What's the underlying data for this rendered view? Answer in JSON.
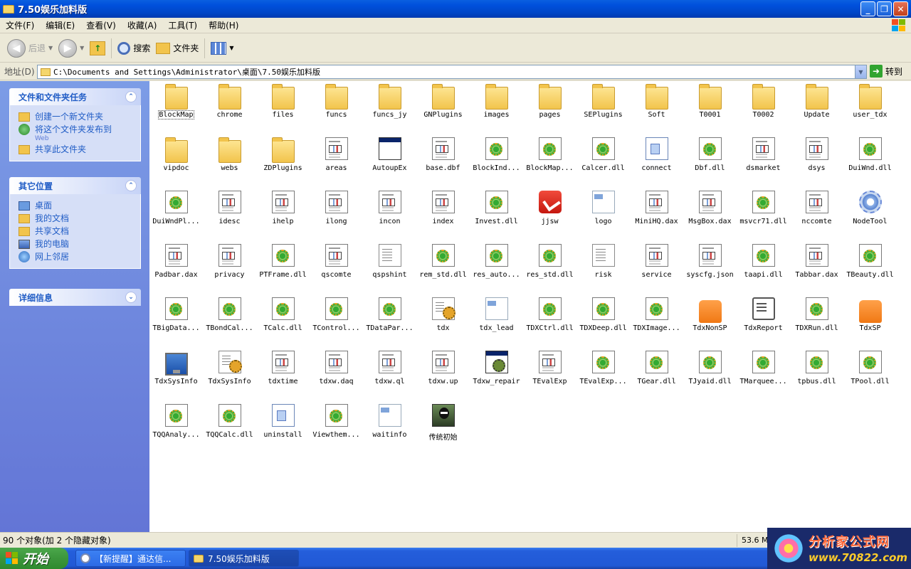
{
  "window": {
    "title": "7.50娱乐加料版",
    "minimize": "_",
    "maximize": "❐",
    "close": "✕"
  },
  "menu": [
    "文件(F)",
    "编辑(E)",
    "查看(V)",
    "收藏(A)",
    "工具(T)",
    "帮助(H)"
  ],
  "toolbar": {
    "back": "后退",
    "search": "搜索",
    "folders": "文件夹"
  },
  "address": {
    "label": "地址(D)",
    "path": "C:\\Documents and Settings\\Administrator\\桌面\\7.50娱乐加料版",
    "go": "转到"
  },
  "left_panels": {
    "tasks": {
      "title": "文件和文件夹任务",
      "items": [
        "创建一个新文件夹",
        "将这个文件夹发布到",
        "共享此文件夹"
      ],
      "publish_sub": "Web"
    },
    "places": {
      "title": "其它位置",
      "items": [
        "桌面",
        "我的文档",
        "共享文档",
        "我的电脑",
        "网上邻居"
      ]
    },
    "details": {
      "title": "详细信息"
    }
  },
  "files": [
    {
      "name": "BlockMap",
      "icon": "folder"
    },
    {
      "name": "chrome",
      "icon": "folder"
    },
    {
      "name": "files",
      "icon": "folder"
    },
    {
      "name": "funcs",
      "icon": "folder"
    },
    {
      "name": "funcs_jy",
      "icon": "folder"
    },
    {
      "name": "GNPlugins",
      "icon": "folder"
    },
    {
      "name": "images",
      "icon": "folder"
    },
    {
      "name": "pages",
      "icon": "folder"
    },
    {
      "name": "SEPlugins",
      "icon": "folder"
    },
    {
      "name": "Soft",
      "icon": "folder"
    },
    {
      "name": "T0001",
      "icon": "folder"
    },
    {
      "name": "T0002",
      "icon": "folder"
    },
    {
      "name": "Update",
      "icon": "folder"
    },
    {
      "name": "user_tdx",
      "icon": "folder"
    },
    {
      "name": "vipdoc",
      "icon": "folder"
    },
    {
      "name": "webs",
      "icon": "folder"
    },
    {
      "name": "ZDPlugins",
      "icon": "folder"
    },
    {
      "name": "areas",
      "icon": "doc"
    },
    {
      "name": "AutoupEx",
      "icon": "exe"
    },
    {
      "name": "base.dbf",
      "icon": "doc"
    },
    {
      "name": "BlockInd...",
      "icon": "dll"
    },
    {
      "name": "BlockMap...",
      "icon": "dll"
    },
    {
      "name": "Calcer.dll",
      "icon": "dll"
    },
    {
      "name": "connect",
      "icon": "generic"
    },
    {
      "name": "Dbf.dll",
      "icon": "dll"
    },
    {
      "name": "dsmarket",
      "icon": "doc"
    },
    {
      "name": "dsys",
      "icon": "doc"
    },
    {
      "name": "DuiWnd.dll",
      "icon": "dll"
    },
    {
      "name": "DuiWndPl...",
      "icon": "dll"
    },
    {
      "name": "idesc",
      "icon": "doc"
    },
    {
      "name": "ihelp",
      "icon": "doc"
    },
    {
      "name": "ilong",
      "icon": "doc"
    },
    {
      "name": "incon",
      "icon": "doc"
    },
    {
      "name": "index",
      "icon": "doc"
    },
    {
      "name": "Invest.dll",
      "icon": "dll"
    },
    {
      "name": "jjsw",
      "icon": "red"
    },
    {
      "name": "logo",
      "icon": "img"
    },
    {
      "name": "MiniHQ.dax",
      "icon": "doc"
    },
    {
      "name": "MsgBox.dax",
      "icon": "doc"
    },
    {
      "name": "msvcr71.dll",
      "icon": "dll"
    },
    {
      "name": "nccomte",
      "icon": "doc"
    },
    {
      "name": "NodeTool",
      "icon": "gear"
    },
    {
      "name": "Padbar.dax",
      "icon": "doc"
    },
    {
      "name": "privacy",
      "icon": "doc"
    },
    {
      "name": "PTFrame.dll",
      "icon": "dll"
    },
    {
      "name": "qscomte",
      "icon": "doc"
    },
    {
      "name": "qspshint",
      "icon": "text"
    },
    {
      "name": "rem_std.dll",
      "icon": "dll"
    },
    {
      "name": "res_auto...",
      "icon": "dll"
    },
    {
      "name": "res_std.dll",
      "icon": "dll"
    },
    {
      "name": "risk",
      "icon": "text"
    },
    {
      "name": "service",
      "icon": "doc"
    },
    {
      "name": "syscfg.json",
      "icon": "doc"
    },
    {
      "name": "taapi.dll",
      "icon": "dll"
    },
    {
      "name": "Tabbar.dax",
      "icon": "doc"
    },
    {
      "name": "TBeauty.dll",
      "icon": "dll"
    },
    {
      "name": "TBigData...",
      "icon": "dll"
    },
    {
      "name": "TBondCal...",
      "icon": "dll"
    },
    {
      "name": "TCalc.dll",
      "icon": "dll"
    },
    {
      "name": "TControl...",
      "icon": "dll"
    },
    {
      "name": "TDataPar...",
      "icon": "dll"
    },
    {
      "name": "tdx",
      "icon": "txtwrite"
    },
    {
      "name": "tdx_lead",
      "icon": "img"
    },
    {
      "name": "TDXCtrl.dll",
      "icon": "dll"
    },
    {
      "name": "TDXDeep.dll",
      "icon": "dll"
    },
    {
      "name": "TDXImage...",
      "icon": "dll"
    },
    {
      "name": "TdxNonSP",
      "icon": "lock"
    },
    {
      "name": "TdxReport",
      "icon": "report"
    },
    {
      "name": "TDXRun.dll",
      "icon": "dll"
    },
    {
      "name": "TdxSP",
      "icon": "lock"
    },
    {
      "name": "TdxSysInfo",
      "icon": "monitor"
    },
    {
      "name": "TdxSysInfo",
      "icon": "txtwrite"
    },
    {
      "name": "tdxtime",
      "icon": "doc"
    },
    {
      "name": "tdxw.daq",
      "icon": "doc"
    },
    {
      "name": "tdxw.ql",
      "icon": "doc"
    },
    {
      "name": "tdxw.up",
      "icon": "doc"
    },
    {
      "name": "Tdxw_repair",
      "icon": "gearexe"
    },
    {
      "name": "TEvalExp",
      "icon": "doc"
    },
    {
      "name": "TEvalExp...",
      "icon": "dll"
    },
    {
      "name": "TGear.dll",
      "icon": "dll"
    },
    {
      "name": "TJyaid.dll",
      "icon": "dll"
    },
    {
      "name": "TMarquee...",
      "icon": "dll"
    },
    {
      "name": "tpbus.dll",
      "icon": "dll"
    },
    {
      "name": "TPool.dll",
      "icon": "dll"
    },
    {
      "name": "TQQAnaly...",
      "icon": "dll"
    },
    {
      "name": "TQQCalc.dll",
      "icon": "dll"
    },
    {
      "name": "uninstall",
      "icon": "generic"
    },
    {
      "name": "Viewthem...",
      "icon": "dll"
    },
    {
      "name": "waitinfo",
      "icon": "img"
    },
    {
      "name": "传统初始",
      "icon": "photo"
    }
  ],
  "status": {
    "count": "90 个对象(加 2 个隐藏对象)",
    "size": "53.6 M"
  },
  "taskbar": {
    "start": "开始",
    "items": [
      "【新提醒】通达信...",
      "7.50娱乐加料版"
    ]
  },
  "watermark": {
    "line1": "分析家公式网",
    "line2": "www.70822.com"
  }
}
